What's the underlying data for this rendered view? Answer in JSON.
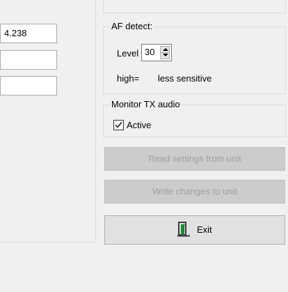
{
  "left_panel": {
    "fields": [
      {
        "value": "4.238"
      },
      {
        "value": ""
      },
      {
        "value": ""
      }
    ]
  },
  "af_detect": {
    "title": "AF detect:",
    "level_label": "Level",
    "level_value": "30",
    "note_prefix": "high=",
    "note_text": "less sensitive"
  },
  "monitor": {
    "title": "Monitor TX audio",
    "checkbox_label": "Active",
    "checked": true
  },
  "buttons": {
    "read": "Read settings from unit",
    "write": "Write changes to unit",
    "exit": "Exit"
  },
  "icons": {
    "exit": "exit-door-icon",
    "checkbox": "checkmark-icon",
    "spin_up": "arrow-up-icon",
    "spin_down": "arrow-down-icon"
  },
  "colors": {
    "window_bg": "#f0f0f0",
    "disabled_button_bg": "#cccccc",
    "disabled_text": "#a0a0a0",
    "exit_icon_green": "#1b8a3a",
    "exit_icon_dark": "#3c3c3c"
  }
}
